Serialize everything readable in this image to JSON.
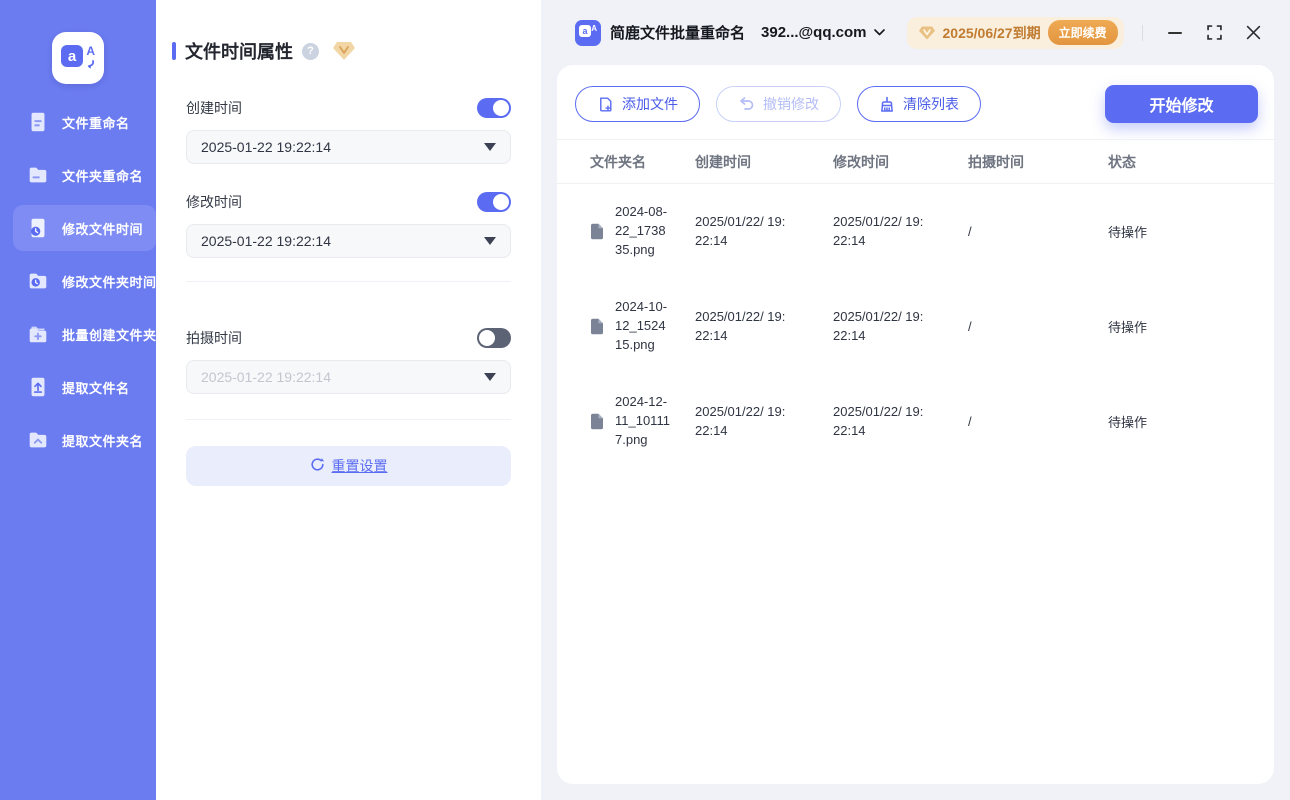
{
  "app": {
    "name": "简鹿文件批量重命名",
    "logo_letter_main": "a",
    "logo_letter_sub": "A"
  },
  "sidebar": {
    "items": [
      {
        "label": "文件重命名"
      },
      {
        "label": "文件夹重命名"
      },
      {
        "label": "修改文件时间",
        "active": true
      },
      {
        "label": "修改文件夹时间"
      },
      {
        "label": "批量创建文件夹"
      },
      {
        "label": "提取文件名"
      },
      {
        "label": "提取文件夹名"
      }
    ]
  },
  "settings": {
    "title": "文件时间属性",
    "help_glyph": "?",
    "fields": [
      {
        "label": "创建时间",
        "enabled": true,
        "value": "2025-01-22 19:22:14"
      },
      {
        "label": "修改时间",
        "enabled": true,
        "value": "2025-01-22 19:22:14"
      },
      {
        "label": "拍摄时间",
        "enabled": false,
        "value": "2025-01-22 19:22:14"
      }
    ],
    "reset_label": "重置设置"
  },
  "header": {
    "account": "392...@qq.com",
    "expiry": "2025/06/27到期",
    "renew_label": "立即续费"
  },
  "toolbar": {
    "add_label": "添加文件",
    "undo_label": "撤销修改",
    "clear_label": "清除列表",
    "start_label": "开始修改"
  },
  "table": {
    "columns": [
      "文件夹名",
      "创建时间",
      "修改时间",
      "拍摄时间",
      "状态"
    ],
    "rows": [
      {
        "name": "2024-08-22_173835.png",
        "created": "2025/01/22/ 19:22:14",
        "modified": "2025/01/22/ 19:22:14",
        "shot": "/",
        "status": "待操作"
      },
      {
        "name": "2024-10-12_152415.png",
        "created": "2025/01/22/ 19:22:14",
        "modified": "2025/01/22/ 19:22:14",
        "shot": "/",
        "status": "待操作"
      },
      {
        "name": "2024-12-11_101117.png",
        "created": "2025/01/22/ 19:22:14",
        "modified": "2025/01/22/ 19:22:14",
        "shot": "/",
        "status": "待操作"
      }
    ]
  },
  "colors": {
    "accent": "#5b6cf2",
    "sidebar": "#6b7bf0",
    "sidebar_active": "#7e8cf3",
    "panel_bg": "#f0f2f7",
    "badge_bg": "#faeedd",
    "badge_text": "#c07c31",
    "renew_bg": "#e8a24b",
    "toggle_off": "#5b6375"
  }
}
